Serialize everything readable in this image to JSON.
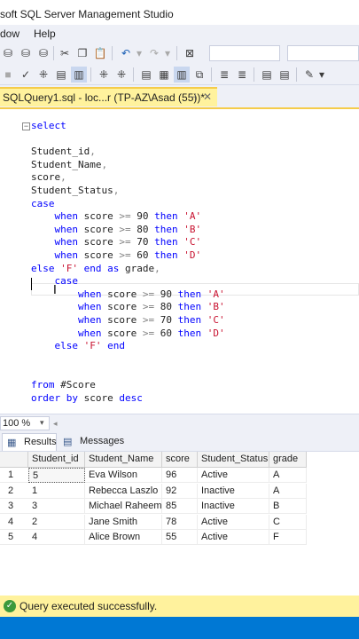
{
  "window": {
    "title": "soft SQL Server Management Studio"
  },
  "menu": {
    "items": [
      "dow",
      "Help"
    ]
  },
  "colors": {
    "tab_accent": "#fff29d",
    "keyword": "#0000ff",
    "string": "#c8102e",
    "status_ok": "#3c9a3c",
    "statusbar": "#0078d4"
  },
  "toolbar1": {
    "icons": [
      "mdx-query-icon",
      "dmx-query-icon",
      "xmla-query-icon",
      "cut-icon",
      "copy-icon",
      "paste-icon",
      "undo-icon",
      "redo-icon",
      "object-explorer-icon"
    ]
  },
  "toolbar2": {
    "icons": [
      "stop-icon",
      "parse-check-icon",
      "display-plan-icon",
      "results-to-text-icon",
      "results-to-grid-icon",
      "include-plan-icon",
      "client-stats-icon",
      "results-to-file-icon",
      "comment-icon",
      "uncomment-icon",
      "indent-icon",
      "specify-values-icon"
    ]
  },
  "editor_tab": {
    "label": "SQLQuery1.sql - loc...r (TP-AZ\\Asad (55))*",
    "pin": "⊣",
    "close": "✕"
  },
  "editor": {
    "outline_toggle": "⊟",
    "lines": [
      {
        "indent": "",
        "tokens": [
          {
            "t": "select",
            "c": "kw"
          }
        ]
      },
      {
        "indent": "",
        "tokens": []
      },
      {
        "indent": "",
        "tokens": [
          {
            "t": "Student_id",
            "c": ""
          },
          {
            "t": ",",
            "c": "gr"
          }
        ]
      },
      {
        "indent": "",
        "tokens": [
          {
            "t": "Student_Name",
            "c": ""
          },
          {
            "t": ",",
            "c": "gr"
          }
        ]
      },
      {
        "indent": "",
        "tokens": [
          {
            "t": "score",
            "c": ""
          },
          {
            "t": ",",
            "c": "gr"
          }
        ]
      },
      {
        "indent": "",
        "tokens": [
          {
            "t": "Student_Status",
            "c": ""
          },
          {
            "t": ",",
            "c": "gr"
          }
        ]
      },
      {
        "indent": "",
        "tokens": [
          {
            "t": "case",
            "c": "kw"
          }
        ]
      },
      {
        "indent": "    ",
        "tokens": [
          {
            "t": "when",
            "c": "kw"
          },
          {
            "t": " score ",
            "c": ""
          },
          {
            "t": ">=",
            "c": "gr"
          },
          {
            "t": " 90 ",
            "c": ""
          },
          {
            "t": "then",
            "c": "kw"
          },
          {
            "t": " 'A'",
            "c": "st"
          }
        ]
      },
      {
        "indent": "    ",
        "tokens": [
          {
            "t": "when",
            "c": "kw"
          },
          {
            "t": " score ",
            "c": ""
          },
          {
            "t": ">=",
            "c": "gr"
          },
          {
            "t": " 80 ",
            "c": ""
          },
          {
            "t": "then",
            "c": "kw"
          },
          {
            "t": " 'B'",
            "c": "st"
          }
        ]
      },
      {
        "indent": "    ",
        "tokens": [
          {
            "t": "when",
            "c": "kw"
          },
          {
            "t": " score ",
            "c": ""
          },
          {
            "t": ">=",
            "c": "gr"
          },
          {
            "t": " 70 ",
            "c": ""
          },
          {
            "t": "then",
            "c": "kw"
          },
          {
            "t": " 'C'",
            "c": "st"
          }
        ]
      },
      {
        "indent": "    ",
        "tokens": [
          {
            "t": "when",
            "c": "kw"
          },
          {
            "t": " score ",
            "c": ""
          },
          {
            "t": ">=",
            "c": "gr"
          },
          {
            "t": " 60 ",
            "c": ""
          },
          {
            "t": "then",
            "c": "kw"
          },
          {
            "t": " 'D'",
            "c": "st"
          }
        ]
      },
      {
        "indent": "",
        "tokens": [
          {
            "t": "else",
            "c": "kw"
          },
          {
            "t": " 'F'",
            "c": "st"
          },
          {
            "t": " end",
            "c": "kw"
          },
          {
            "t": " as",
            "c": "kw"
          },
          {
            "t": " grade",
            "c": ""
          },
          {
            "t": ",",
            "c": "gr"
          }
        ]
      },
      {
        "indent": "    ",
        "tokens": [
          {
            "t": "case",
            "c": "kw"
          }
        ]
      },
      {
        "indent": "        ",
        "tokens": [
          {
            "t": "when",
            "c": "kw"
          },
          {
            "t": " score ",
            "c": ""
          },
          {
            "t": ">=",
            "c": "gr"
          },
          {
            "t": " 90 ",
            "c": ""
          },
          {
            "t": "then",
            "c": "kw"
          },
          {
            "t": " 'A'",
            "c": "st"
          }
        ]
      },
      {
        "indent": "        ",
        "tokens": [
          {
            "t": "when",
            "c": "kw"
          },
          {
            "t": " score ",
            "c": ""
          },
          {
            "t": ">=",
            "c": "gr"
          },
          {
            "t": " 80 ",
            "c": ""
          },
          {
            "t": "then",
            "c": "kw"
          },
          {
            "t": " 'B'",
            "c": "st"
          }
        ]
      },
      {
        "indent": "        ",
        "tokens": [
          {
            "t": "when",
            "c": "kw"
          },
          {
            "t": " score ",
            "c": ""
          },
          {
            "t": ">=",
            "c": "gr"
          },
          {
            "t": " 70 ",
            "c": ""
          },
          {
            "t": "then",
            "c": "kw"
          },
          {
            "t": " 'C'",
            "c": "st"
          }
        ]
      },
      {
        "indent": "        ",
        "tokens": [
          {
            "t": "when",
            "c": "kw"
          },
          {
            "t": " score ",
            "c": ""
          },
          {
            "t": ">=",
            "c": "gr"
          },
          {
            "t": " 60 ",
            "c": ""
          },
          {
            "t": "then",
            "c": "kw"
          },
          {
            "t": " 'D'",
            "c": "st"
          }
        ]
      },
      {
        "indent": "    ",
        "tokens": [
          {
            "t": "else",
            "c": "kw"
          },
          {
            "t": " 'F'",
            "c": "st"
          },
          {
            "t": " end",
            "c": "kw"
          }
        ]
      },
      {
        "indent": "",
        "tokens": []
      },
      {
        "indent": "",
        "tokens": []
      },
      {
        "indent": "",
        "tokens": [
          {
            "t": "from",
            "c": "kw"
          },
          {
            "t": " #Score",
            "c": ""
          }
        ]
      },
      {
        "indent": "",
        "tokens": [
          {
            "t": "order",
            "c": "kw"
          },
          {
            "t": " by",
            "c": "kw"
          },
          {
            "t": " score",
            "c": ""
          },
          {
            "t": " desc",
            "c": "kw"
          }
        ]
      }
    ]
  },
  "zoom": {
    "value": "100 %",
    "dropdown": "▾",
    "scroll_arrow": "◂"
  },
  "results_tabs": [
    {
      "label": "Results",
      "icon": "grid-icon",
      "glyph": "▦"
    },
    {
      "label": "Messages",
      "icon": "messages-icon",
      "glyph": "▤"
    }
  ],
  "results": {
    "columns": [
      "Student_id",
      "Student_Name",
      "score",
      "Student_Status",
      "grade"
    ],
    "rows": [
      {
        "n": "1",
        "cells": [
          "5",
          "Eva Wilson",
          "96",
          "Active",
          "A"
        ]
      },
      {
        "n": "2",
        "cells": [
          "1",
          "Rebecca Laszlo",
          "92",
          "Inactive",
          "A"
        ]
      },
      {
        "n": "3",
        "cells": [
          "3",
          "Michael Raheem",
          "85",
          "Inactive",
          "B"
        ]
      },
      {
        "n": "4",
        "cells": [
          "2",
          "Jane Smith",
          "78",
          "Active",
          "C"
        ]
      },
      {
        "n": "5",
        "cells": [
          "4",
          "Alice Brown",
          "55",
          "Active",
          "F"
        ]
      }
    ]
  },
  "status": {
    "icon": "check-circle-icon",
    "glyph": "✓",
    "message": "Query executed successfully."
  }
}
